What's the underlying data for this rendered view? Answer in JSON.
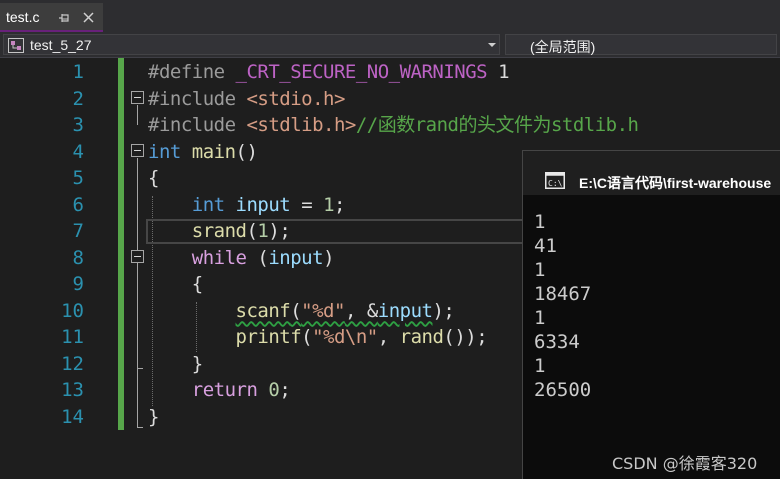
{
  "tab": {
    "label": "test.c"
  },
  "navigation": {
    "project": "test_5_27",
    "scope": "(全局范围)"
  },
  "editor": {
    "line_numbers": [
      "1",
      "2",
      "3",
      "4",
      "5",
      "6",
      "7",
      "8",
      "9",
      "10",
      "11",
      "12",
      "13",
      "14"
    ],
    "lines": [
      {
        "indent": "",
        "tokens": [
          [
            "pp",
            "#define "
          ],
          [
            "macro",
            "_CRT_SECURE_NO_WARNINGS"
          ],
          [
            "plain",
            " 1"
          ]
        ]
      },
      {
        "indent": "",
        "tokens": [
          [
            "pp",
            "#include "
          ],
          [
            "str",
            "<stdio.h>"
          ]
        ]
      },
      {
        "indent": "",
        "tokens": [
          [
            "pp",
            "#include "
          ],
          [
            "str",
            "<stdlib.h>"
          ],
          [
            "cm",
            "//函数rand的头文件为stdlib.h"
          ]
        ]
      },
      {
        "indent": "",
        "tokens": [
          [
            "kw",
            "int"
          ],
          [
            "plain",
            " "
          ],
          [
            "fn",
            "main"
          ],
          [
            "plain",
            "()"
          ]
        ]
      },
      {
        "indent": "",
        "tokens": [
          [
            "plain",
            "{"
          ]
        ]
      },
      {
        "indent": "    ",
        "tokens": [
          [
            "kw",
            "int"
          ],
          [
            "plain",
            " "
          ],
          [
            "var",
            "input"
          ],
          [
            "plain",
            " = "
          ],
          [
            "num",
            "1"
          ],
          [
            "plain",
            ";"
          ]
        ]
      },
      {
        "indent": "    ",
        "tokens": [
          [
            "fn",
            "srand"
          ],
          [
            "plain",
            "("
          ],
          [
            "num",
            "1"
          ],
          [
            "plain",
            ");"
          ]
        ]
      },
      {
        "indent": "    ",
        "tokens": [
          [
            "kw2",
            "while"
          ],
          [
            "plain",
            " ("
          ],
          [
            "var",
            "input"
          ],
          [
            "plain",
            ")"
          ]
        ]
      },
      {
        "indent": "    ",
        "tokens": [
          [
            "plain",
            "{"
          ]
        ]
      },
      {
        "indent": "        ",
        "tokens": [
          [
            "squig-fn",
            "scanf"
          ],
          [
            "squig-plain",
            "("
          ],
          [
            "squig-str",
            "\"%d\""
          ],
          [
            "squig-plain",
            ", &"
          ],
          [
            "squig-var",
            "input"
          ],
          [
            "plain",
            ");"
          ]
        ]
      },
      {
        "indent": "        ",
        "tokens": [
          [
            "fn",
            "printf"
          ],
          [
            "plain",
            "("
          ],
          [
            "str",
            "\"%d\\n\""
          ],
          [
            "plain",
            ", "
          ],
          [
            "fn",
            "rand"
          ],
          [
            "plain",
            "());"
          ]
        ]
      },
      {
        "indent": "    ",
        "tokens": [
          [
            "plain",
            "}"
          ]
        ]
      },
      {
        "indent": "    ",
        "tokens": [
          [
            "kw2",
            "return"
          ],
          [
            "plain",
            " "
          ],
          [
            "num",
            "0"
          ],
          [
            "plain",
            ";"
          ]
        ]
      },
      {
        "indent": "",
        "tokens": [
          [
            "plain",
            "}"
          ]
        ]
      }
    ]
  },
  "console": {
    "title": "E:\\C语言代码\\first-warehouse",
    "output": [
      "1",
      "41",
      "1",
      "18467",
      "1",
      "6334",
      "1",
      "26500"
    ]
  },
  "watermark": "CSDN @徐霞客320",
  "colors": {
    "keyword": "#569cd6",
    "control_keyword": "#d8a0df",
    "string": "#d69d85",
    "comment": "#57a64a",
    "function": "#dcdcaa",
    "variable": "#9cdcfe",
    "number": "#b5cea8",
    "line_number": "#2b91af",
    "tab_accent": "#68217a"
  }
}
